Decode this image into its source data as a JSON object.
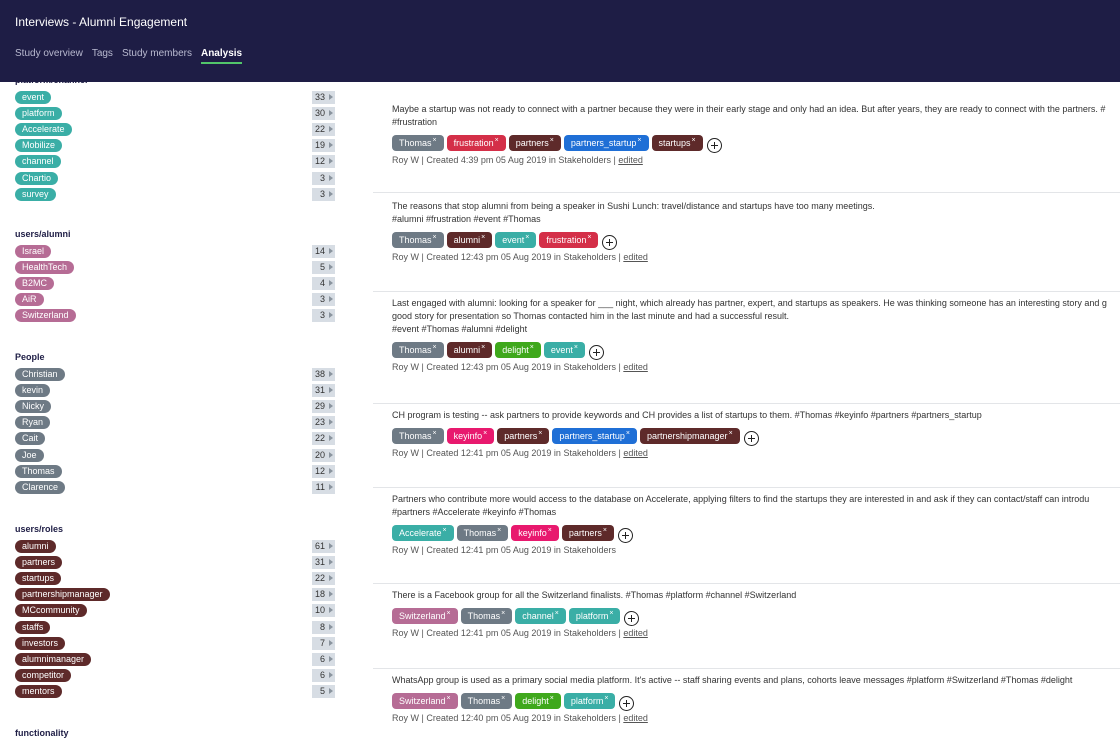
{
  "header": {
    "title": "Interviews - Alumni Engagement",
    "tabs": [
      "Study overview",
      "Tags",
      "Study members",
      "Analysis"
    ],
    "active_tab": "Analysis"
  },
  "colors": {
    "header_bg": "#1e1d45",
    "active_underline": "#52c66a",
    "teal": "#3aaea6",
    "mauve": "#b66c95",
    "slate": "#6e7a85",
    "maroon": "#5e2a2a",
    "red": "#d42f48",
    "blue": "#1f6fd6",
    "green": "#3fa81c",
    "pink": "#e8196e"
  },
  "sidebar": {
    "groups": [
      {
        "title": "platform/channel",
        "color": "#3aaea6",
        "tags": [
          {
            "label": "event",
            "count": "33"
          },
          {
            "label": "platform",
            "count": "30"
          },
          {
            "label": "Accelerate",
            "count": "22"
          },
          {
            "label": "Mobilize",
            "count": "19"
          },
          {
            "label": "channel",
            "count": "12"
          },
          {
            "label": "Chartio",
            "count": "3"
          },
          {
            "label": "survey",
            "count": "3"
          }
        ]
      },
      {
        "title": "users/alumni",
        "color": "#b66c95",
        "tags": [
          {
            "label": "Israel",
            "count": "14"
          },
          {
            "label": "HealthTech",
            "count": "5"
          },
          {
            "label": "B2MC",
            "count": "4"
          },
          {
            "label": "AiR",
            "count": "3"
          },
          {
            "label": "Switzerland",
            "count": "3"
          }
        ]
      },
      {
        "title": "People",
        "color": "#6e7a85",
        "tags": [
          {
            "label": "Christian",
            "count": "38"
          },
          {
            "label": "kevin",
            "count": "31"
          },
          {
            "label": "Nicky",
            "count": "29"
          },
          {
            "label": "Ryan",
            "count": "23"
          },
          {
            "label": "Cait",
            "count": "22"
          },
          {
            "label": "Joe",
            "count": "20"
          },
          {
            "label": "Thomas",
            "count": "12"
          },
          {
            "label": "Clarence",
            "count": "11"
          }
        ]
      },
      {
        "title": "users/roles",
        "color": "#5e2a2a",
        "tags": [
          {
            "label": "alumni",
            "count": "61"
          },
          {
            "label": "partners",
            "count": "31"
          },
          {
            "label": "startups",
            "count": "22"
          },
          {
            "label": "partnershipmanager",
            "count": "18"
          },
          {
            "label": "MCcommunity",
            "count": "10"
          },
          {
            "label": "staffs",
            "count": "8"
          },
          {
            "label": "investors",
            "count": "7"
          },
          {
            "label": "alumnimanager",
            "count": "6"
          },
          {
            "label": "competitor",
            "count": "6"
          },
          {
            "label": "mentors",
            "count": "5"
          }
        ]
      },
      {
        "title": "functionality",
        "color": "#3aaea6",
        "tags": []
      }
    ]
  },
  "entries": [
    {
      "lines": [
        "Maybe a startup was not ready to connect with a partner because they were in their early stage and only had an idea. But after years, they are ready to connect with the partners. #",
        "#frustration"
      ],
      "tags": [
        {
          "label": "Thomas",
          "color": "#6e7a85"
        },
        {
          "label": "frustration",
          "color": "#d42f48"
        },
        {
          "label": "partners",
          "color": "#5e2a2a"
        },
        {
          "label": "partners_startup",
          "color": "#1f6fd6"
        },
        {
          "label": "startups",
          "color": "#5e2a2a"
        }
      ],
      "meta": "Roy W | Created 4:39 pm 05 Aug 2019 in Stakeholders | ",
      "edited": "edited"
    },
    {
      "lines": [
        "The reasons that stop alumni from being a speaker in Sushi Lunch: travel/distance and startups have too many meetings.",
        "#alumni #frustration #event #Thomas"
      ],
      "tags": [
        {
          "label": "Thomas",
          "color": "#6e7a85"
        },
        {
          "label": "alumni",
          "color": "#5e2a2a"
        },
        {
          "label": "event",
          "color": "#3aaea6"
        },
        {
          "label": "frustration",
          "color": "#d42f48"
        }
      ],
      "meta": "Roy W | Created 12:43 pm 05 Aug 2019 in Stakeholders | ",
      "edited": "edited"
    },
    {
      "lines": [
        "Last engaged with alumni: looking for a speaker for ___ night, which already has partner, expert, and startups as speakers. He was thinking someone has an interesting story and g",
        "good story for presentation so Thomas contacted him in the last minute and had a successful result.",
        "#event #Thomas #alumni #delight"
      ],
      "tags": [
        {
          "label": "Thomas",
          "color": "#6e7a85"
        },
        {
          "label": "alumni",
          "color": "#5e2a2a"
        },
        {
          "label": "delight",
          "color": "#3fa81c"
        },
        {
          "label": "event",
          "color": "#3aaea6"
        }
      ],
      "meta": "Roy W | Created 12:43 pm 05 Aug 2019 in Stakeholders | ",
      "edited": "edited"
    },
    {
      "lines": [
        "CH program is testing -- ask partners to provide keywords and CH provides a list of startups to them. #Thomas #keyinfo #partners #partners_startup"
      ],
      "tags": [
        {
          "label": "Thomas",
          "color": "#6e7a85"
        },
        {
          "label": "keyinfo",
          "color": "#e8196e"
        },
        {
          "label": "partners",
          "color": "#5e2a2a"
        },
        {
          "label": "partners_startup",
          "color": "#1f6fd6"
        },
        {
          "label": "partnershipmanager",
          "color": "#5e2a2a"
        }
      ],
      "meta": "Roy W | Created 12:41 pm 05 Aug 2019 in Stakeholders | ",
      "edited": "edited"
    },
    {
      "lines": [
        "Partners who contribute more would access to the database on Accelerate, applying filters to find the startups they are interested in and ask if they can contact/staff can introdu",
        "#partners #Accelerate #keyinfo #Thomas"
      ],
      "tags": [
        {
          "label": "Accelerate",
          "color": "#3aaea6"
        },
        {
          "label": "Thomas",
          "color": "#6e7a85"
        },
        {
          "label": "keyinfo",
          "color": "#e8196e"
        },
        {
          "label": "partners",
          "color": "#5e2a2a"
        }
      ],
      "meta": "Roy W | Created 12:41 pm 05 Aug 2019 in Stakeholders",
      "edited": ""
    },
    {
      "lines": [
        "There is a Facebook group for all the Switzerland finalists. #Thomas #platform #channel #Switzerland"
      ],
      "tags": [
        {
          "label": "Switzerland",
          "color": "#b66c95"
        },
        {
          "label": "Thomas",
          "color": "#6e7a85"
        },
        {
          "label": "channel",
          "color": "#3aaea6"
        },
        {
          "label": "platform",
          "color": "#3aaea6"
        }
      ],
      "meta": "Roy W | Created 12:41 pm 05 Aug 2019 in Stakeholders | ",
      "edited": "edited"
    },
    {
      "lines": [
        "WhatsApp group is used as a primary social media platform. It's active -- staff sharing events and plans, cohorts leave messages #platform #Switzerland #Thomas #delight"
      ],
      "tags": [
        {
          "label": "Switzerland",
          "color": "#b66c95"
        },
        {
          "label": "Thomas",
          "color": "#6e7a85"
        },
        {
          "label": "delight",
          "color": "#3fa81c"
        },
        {
          "label": "platform",
          "color": "#3aaea6"
        }
      ],
      "meta": "Roy W | Created 12:40 pm 05 Aug 2019 in Stakeholders | ",
      "edited": "edited"
    }
  ]
}
